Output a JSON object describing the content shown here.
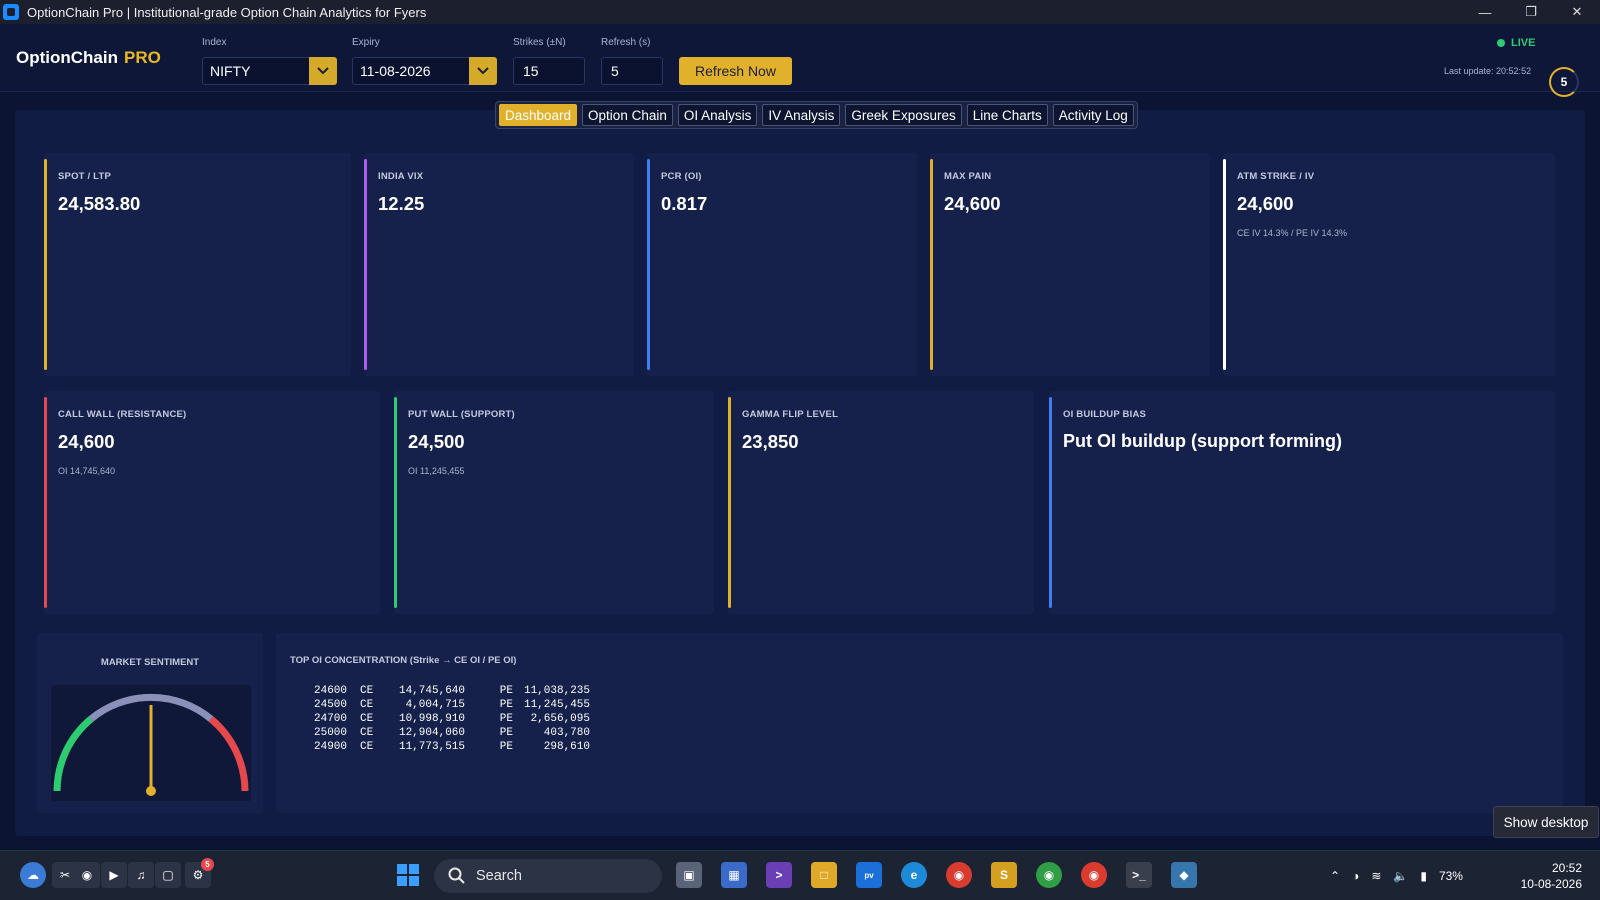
{
  "window": {
    "title": "OptionChain Pro  |  Institutional-grade Option Chain Analytics for Fyers"
  },
  "header": {
    "brand": "OptionChain",
    "brand_suffix": "PRO",
    "index_label": "Index",
    "index_value": "NIFTY",
    "expiry_label": "Expiry",
    "expiry_value": "11-08-2026",
    "strikes_label": "Strikes (±N)",
    "strikes_value": "15",
    "refresh_label": "Refresh (s)",
    "refresh_value": "5",
    "refresh_button": "Refresh Now",
    "live_text": "LIVE",
    "last_update": "Last update: 20:52:52",
    "countdown": "5"
  },
  "tabs": [
    {
      "label": "Dashboard",
      "active": true
    },
    {
      "label": "Option Chain"
    },
    {
      "label": "OI Analysis"
    },
    {
      "label": "IV Analysis"
    },
    {
      "label": "Greek Exposures"
    },
    {
      "label": "Line Charts"
    },
    {
      "label": "Activity Log"
    }
  ],
  "cards": {
    "spot": {
      "label": "SPOT / LTP",
      "value": "24,583.80",
      "color": "#e1b12c"
    },
    "vix": {
      "label": "INDIA VIX",
      "value": "12.25",
      "color": "#b05cf0"
    },
    "pcr": {
      "label": "PCR (OI)",
      "value": "0.817",
      "color": "#3b7ff0"
    },
    "maxpain": {
      "label": "MAX PAIN",
      "value": "24,600",
      "color": "#e1b12c"
    },
    "atm": {
      "label": "ATM STRIKE / IV",
      "value": "24,600",
      "sub": "CE IV 14.3% / PE IV 14.3%",
      "color": "#ffffff"
    },
    "callwall": {
      "label": "CALL WALL (RESISTANCE)",
      "value": "24,600",
      "sub": "OI 14,745,640",
      "color": "#e5484d"
    },
    "putwall": {
      "label": "PUT WALL (SUPPORT)",
      "value": "24,500",
      "sub": "OI 11,245,455",
      "color": "#2ecc71"
    },
    "gamma": {
      "label": "GAMMA FLIP LEVEL",
      "value": "23,850",
      "color": "#e1b12c"
    },
    "bias": {
      "label": "OI BUILDUP BIAS",
      "value": "Put OI buildup (support forming)",
      "color": "#3b7ff0"
    }
  },
  "sentiment": {
    "label": "MARKET SENTIMENT",
    "needle_fraction": 0.5
  },
  "top_oi": {
    "label": "TOP OI CONCENTRATION (Strike → CE OI / PE OI)",
    "rows": [
      {
        "strike": "24600",
        "ce_tag": "CE",
        "ce": "14,745,640",
        "pe_tag": "PE",
        "pe": "11,038,235"
      },
      {
        "strike": "24500",
        "ce_tag": "CE",
        "ce": "4,004,715",
        "pe_tag": "PE",
        "pe": "11,245,455"
      },
      {
        "strike": "24700",
        "ce_tag": "CE",
        "ce": "10,998,910",
        "pe_tag": "PE",
        "pe": "2,656,095"
      },
      {
        "strike": "25000",
        "ce_tag": "CE",
        "ce": "12,904,060",
        "pe_tag": "PE",
        "pe": "403,780"
      },
      {
        "strike": "24900",
        "ce_tag": "CE",
        "ce": "11,773,515",
        "pe_tag": "PE",
        "pe": "298,610"
      }
    ]
  },
  "tooltip": "Show desktop",
  "taskbar": {
    "search_placeholder": "Search",
    "battery": "73%",
    "time": "20:52",
    "date": "10-08-2026",
    "notification_badge": "5"
  }
}
